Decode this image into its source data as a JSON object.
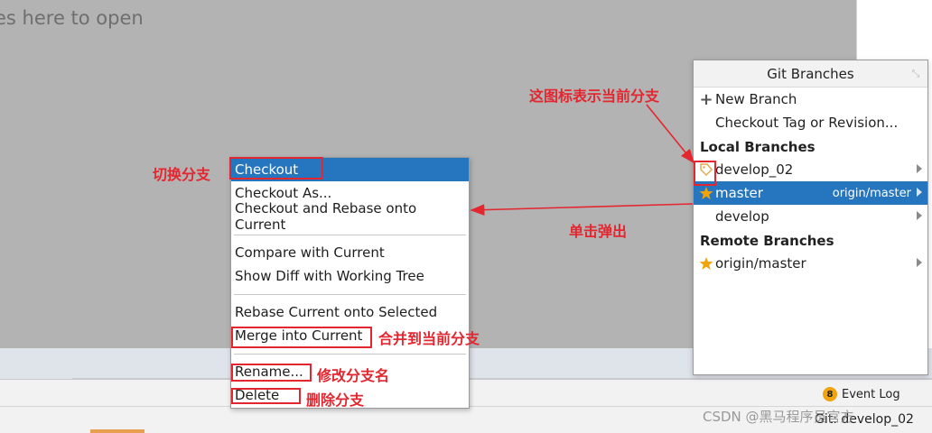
{
  "editor": {
    "hint": "es here to open"
  },
  "popup": {
    "title": "Git Branches",
    "actions": [
      {
        "label": "New Branch",
        "icon": "plus-icon"
      },
      {
        "label": "Checkout Tag or Revision..."
      }
    ],
    "local_title": "Local Branches",
    "local": [
      {
        "name": "develop_02",
        "icon": "tag-icon"
      },
      {
        "name": "master",
        "icon": "star-icon",
        "tracking": "origin/master",
        "selected": true
      },
      {
        "name": "develop"
      }
    ],
    "remote_title": "Remote Branches",
    "remote": [
      {
        "name": "origin/master",
        "icon": "star-icon"
      }
    ]
  },
  "context_menu": {
    "items": [
      "Checkout",
      "Checkout As...",
      "Checkout and Rebase onto Current",
      "Compare with Current",
      "Show Diff with Working Tree",
      "Rebase Current onto Selected",
      "Merge into Current",
      "Rename...",
      "Delete"
    ]
  },
  "annotations": {
    "current_branch_icon": "这图标表示当前分支",
    "switch": "切换分支",
    "click_popup": "单击弹出",
    "merge": "合并到当前分支",
    "rename": "修改分支名",
    "delete": "删除分支"
  },
  "status": {
    "event_count": "8",
    "event_log": "Event Log",
    "git_branch": "Git: develop_02",
    "watermark": "CSDN @黑马程序员官方"
  },
  "colors": {
    "selection": "#2675bf",
    "annotation": "#e3262f",
    "star": "#f0a30a"
  }
}
